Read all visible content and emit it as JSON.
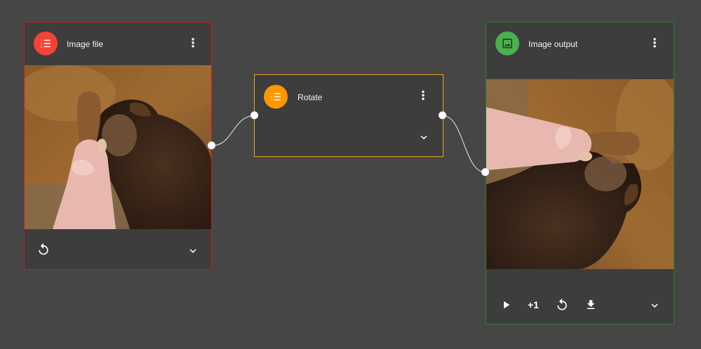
{
  "colors": {
    "canvas": "#464646",
    "node_bg": "#3d3d3d",
    "input_border": "#d21a1a",
    "rotate_border": "#f0a020",
    "output_border": "#2e7d32",
    "input_badge": "#f44336",
    "rotate_badge": "#ff9800",
    "output_badge": "#4caf50",
    "wire": "#cfcfcf"
  },
  "nodes": {
    "input": {
      "title": "Image file",
      "badge_icon": "list-numbered-icon",
      "menu_icon": "more-vert-icon",
      "footer_icons": [
        "refresh-icon",
        "chevron-down-icon"
      ],
      "preview": "photo of a girl in a pink dress with a camel, autumn background"
    },
    "rotate": {
      "title": "Rotate",
      "badge_icon": "list-numbered-icon",
      "menu_icon": "more-vert-icon",
      "footer_icons": [
        "chevron-down-icon"
      ]
    },
    "output": {
      "title": "Image output",
      "badge_icon": "image-icon",
      "menu_icon": "more-vert-icon",
      "counter": "+1",
      "footer_icons": [
        "play-icon",
        "refresh-icon",
        "download-icon",
        "chevron-down-icon"
      ],
      "preview": "same photo rotated 90 degrees clockwise"
    }
  }
}
